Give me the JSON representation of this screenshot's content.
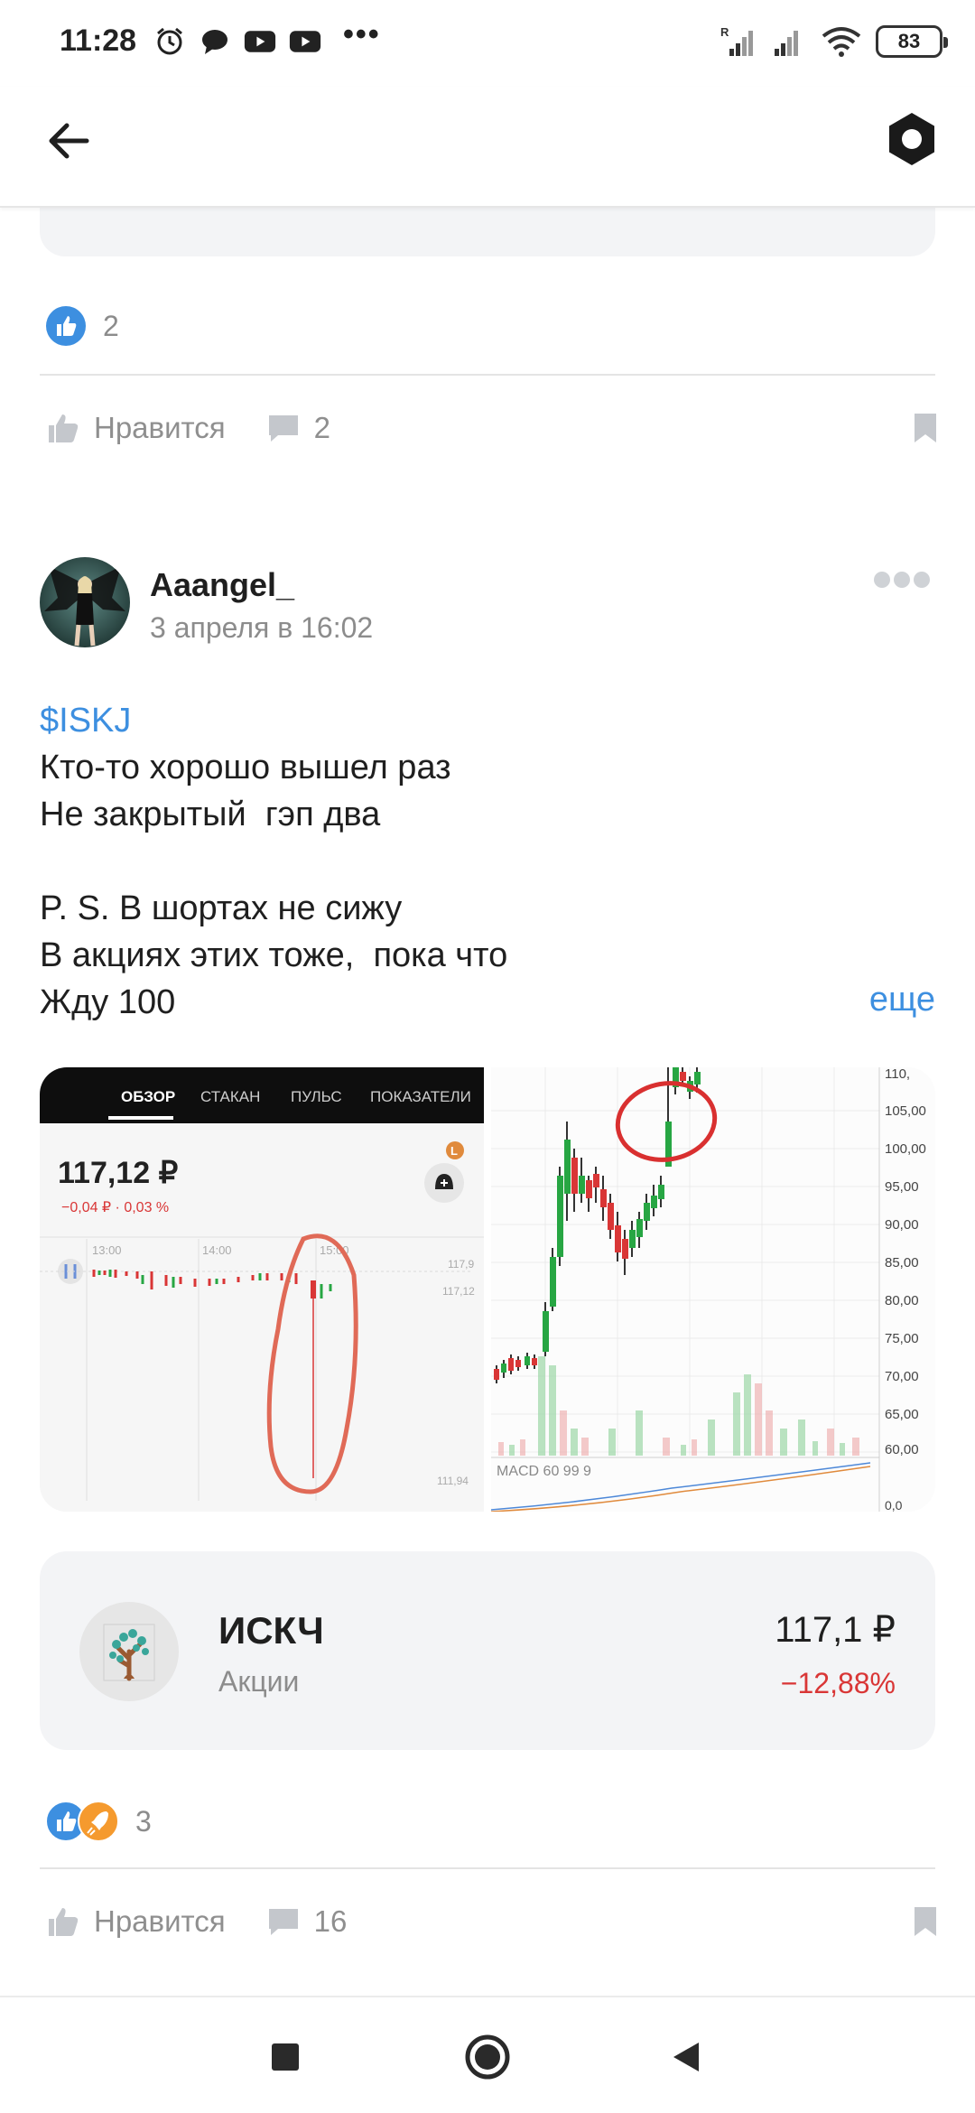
{
  "status_bar": {
    "time": "11:28",
    "battery": "83",
    "more": "•••"
  },
  "app_bar": {
    "back_icon": "arrow-left-icon",
    "settings_icon": "hexagon-icon"
  },
  "prev_post": {
    "reaction_count": "2",
    "like_label": "Нравится",
    "comment_count": "2"
  },
  "post": {
    "author_name": "Aaangel_",
    "date": "3 апреля в 16:02",
    "ticker": "$ISKJ",
    "lines": [
      "Кто-то хорошо вышел раз",
      "Не закрытый  гэп два",
      "",
      "P. S. В шортах не сижу",
      "В акциях этих тоже,  пока что",
      "Жду 100"
    ],
    "more_label": "еще",
    "reaction_count": "3",
    "like_label": "Нравится",
    "comment_count": "16"
  },
  "screenshot1": {
    "tabs": [
      "ОБЗОР",
      "СТАКАН",
      "ПУЛЬС",
      "ПОКАЗАТЕЛИ"
    ],
    "price": "117,12 ₽",
    "change": "−0,04 ₽ · 0,03 %",
    "times": [
      "13:00",
      "14:00",
      "15:00"
    ],
    "price_hi": "117,9",
    "price_cur": "117,12",
    "price_lo": "111,94",
    "badge": "L"
  },
  "screenshot2": {
    "axis": [
      "110,",
      "105,00",
      "100,00",
      "95,00",
      "90,00",
      "85,00",
      "80,00",
      "75,00",
      "70,00",
      "65,00",
      "60,00"
    ],
    "macd_label": "MACD 60 99 9",
    "bottom_label": "0,0"
  },
  "stock": {
    "name": "ИСКЧ",
    "type": "Акции",
    "price": "117,1 ₽",
    "change": "−12,88%"
  },
  "colors": {
    "accent": "#3d8fe0",
    "negative": "#d93636",
    "muted": "#8c8c8c",
    "card_bg": "#f3f4f6"
  }
}
